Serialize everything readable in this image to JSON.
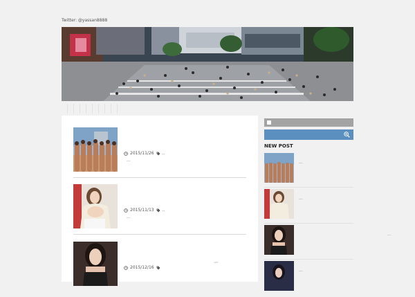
{
  "header": {
    "twitter": "Twitter: @yassan8888"
  },
  "posts": [
    {
      "date": "2015/11/26",
      "tags": "..",
      "excerpt": "..."
    },
    {
      "date": "2015/11/13",
      "tags": "..",
      "excerpt": "..."
    },
    {
      "date": "2015/12/16",
      "tags": "",
      "excerpt": "..."
    }
  ],
  "sidebar": {
    "heading": "NEW POST",
    "posts": [
      {
        "excerpt": "..."
      },
      {
        "excerpt": "..."
      },
      {
        "excerpt": ""
      },
      {
        "excerpt": "..."
      }
    ]
  },
  "misc": {
    "stray1": "...",
    "stray2": "..."
  },
  "colors": {
    "page_bg": "#f1f1f1",
    "rss_bar": "#a3a3a3",
    "search_bar": "#5b8fc0"
  },
  "icons": {
    "date": "clock-icon",
    "tag": "tag-icon",
    "rss": "rss-icon",
    "search": "zoom-in-search-icon"
  }
}
